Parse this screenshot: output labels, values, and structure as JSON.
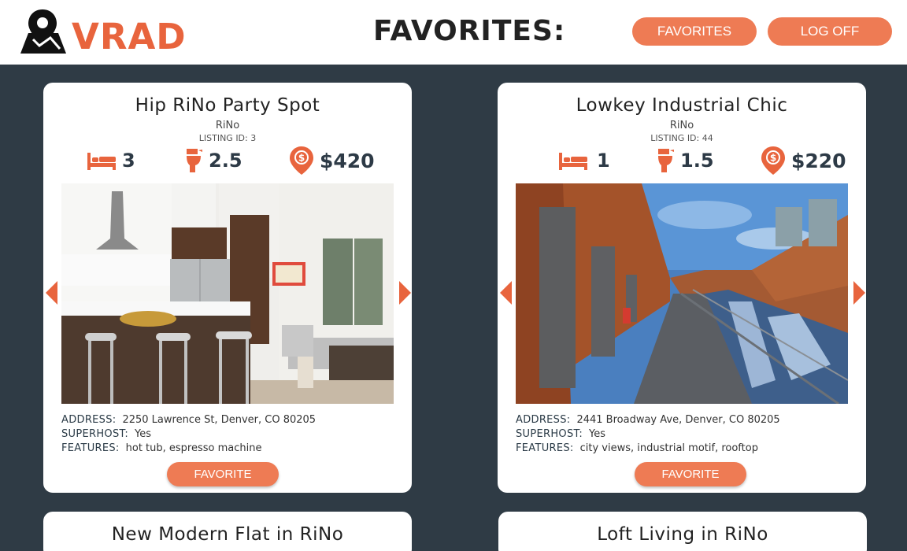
{
  "brand": {
    "name": "VRAD",
    "accent": "#e8643d"
  },
  "header": {
    "title": "FAVORITES:"
  },
  "nav": {
    "favorites_label": "FAVORITES",
    "logoff_label": "LOG OFF"
  },
  "labels": {
    "address": "ADDRESS:",
    "superhost": "SUPERHOST:",
    "features": "FEATURES:",
    "favorite_button": "FAVORITE"
  },
  "listings": [
    {
      "title": "Hip RiNo Party Spot",
      "neighborhood": "RiNo",
      "listing_id": "LISTING ID: 3",
      "beds": "3",
      "baths": "2.5",
      "price": "$420",
      "address": "2250 Lawrence St, Denver, CO 80205",
      "superhost": "Yes",
      "features": "hot tub, espresso machine",
      "photo_icon": "kitchen-living-room-photo"
    },
    {
      "title": "Lowkey Industrial Chic",
      "neighborhood": "RiNo",
      "listing_id": "LISTING ID: 44",
      "beds": "1",
      "baths": "1.5",
      "price": "$220",
      "address": "2441 Broadway Ave, Denver, CO 80205",
      "superhost": "Yes",
      "features": "city views, industrial motif, rooftop",
      "photo_icon": "industrial-balcony-photo"
    },
    {
      "title": "New Modern Flat in RiNo"
    },
    {
      "title": "Loft Living in RiNo"
    }
  ]
}
